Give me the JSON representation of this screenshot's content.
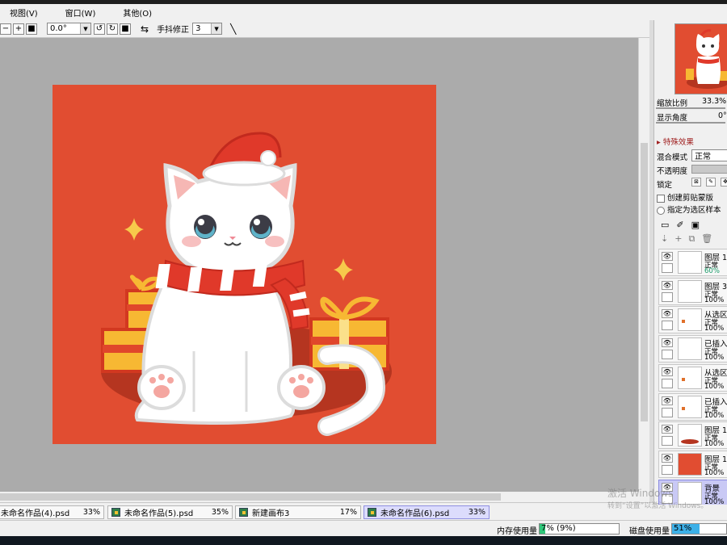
{
  "menu": [
    "视图(V)",
    "窗口(W)",
    "其他(O)"
  ],
  "toolbar": {
    "rotation_value": "0.0°",
    "stabilizer_label": "手抖修正",
    "stabilizer_value": "3"
  },
  "navigator": {
    "zoom_label": "缩放比例",
    "zoom_value": "33.3%",
    "angle_label": "显示角度",
    "angle_value": "0°"
  },
  "effects_header": "特殊效果",
  "layer_props": {
    "blend_label": "混合模式",
    "blend_value": "正常",
    "opacity_label": "不透明度",
    "lock_label": "锁定",
    "clip_label": "创建剪贴蒙版",
    "sample_label": "指定为选区样本"
  },
  "layers": [
    {
      "name": "图层 1",
      "mode": "正常",
      "opacity": "60%",
      "thumb": "blank"
    },
    {
      "name": "图层 3",
      "mode": "正常",
      "opacity": "100%",
      "thumb": "blank"
    },
    {
      "name": "从选区",
      "mode": "正常",
      "opacity": "100%",
      "thumb": "dot"
    },
    {
      "name": "已插入",
      "mode": "正常",
      "opacity": "100%",
      "thumb": "blank"
    },
    {
      "name": "从选区",
      "mode": "正常",
      "opacity": "100%",
      "thumb": "dot"
    },
    {
      "name": "已插入",
      "mode": "正常",
      "opacity": "100%",
      "thumb": "dot"
    },
    {
      "name": "图层 1",
      "mode": "正常",
      "opacity": "100%",
      "thumb": "ellipse"
    },
    {
      "name": "图层 1",
      "mode": "正常",
      "opacity": "100%",
      "thumb": "red"
    },
    {
      "name": "背景",
      "mode": "正常",
      "opacity": "100%",
      "thumb": "blank"
    }
  ],
  "tabs": [
    {
      "name": "未命名作品(4).psd",
      "zoom": "33%"
    },
    {
      "name": "未命名作品(5).psd",
      "zoom": "35%"
    },
    {
      "name": "新建画布3",
      "zoom": "17%"
    },
    {
      "name": "未命名作品(6).psd",
      "zoom": "33%"
    }
  ],
  "status": {
    "memory_label": "内存使用量",
    "memory_value": "7% (9%)",
    "memory_fraction": 0.07,
    "disk_label": "磁盘使用量",
    "disk_value": "51%",
    "disk_fraction": 0.51
  },
  "watermark": [
    "激活 Windows",
    "转到“设置”以激活 Windows。"
  ],
  "colors": {
    "canvas_bg": "#e14d31",
    "workspace_bg": "#ababab",
    "selected_tab": "#dcdcfc",
    "selected_layer": "#c9c9f5",
    "disk_meter": "#3cb0e8"
  }
}
